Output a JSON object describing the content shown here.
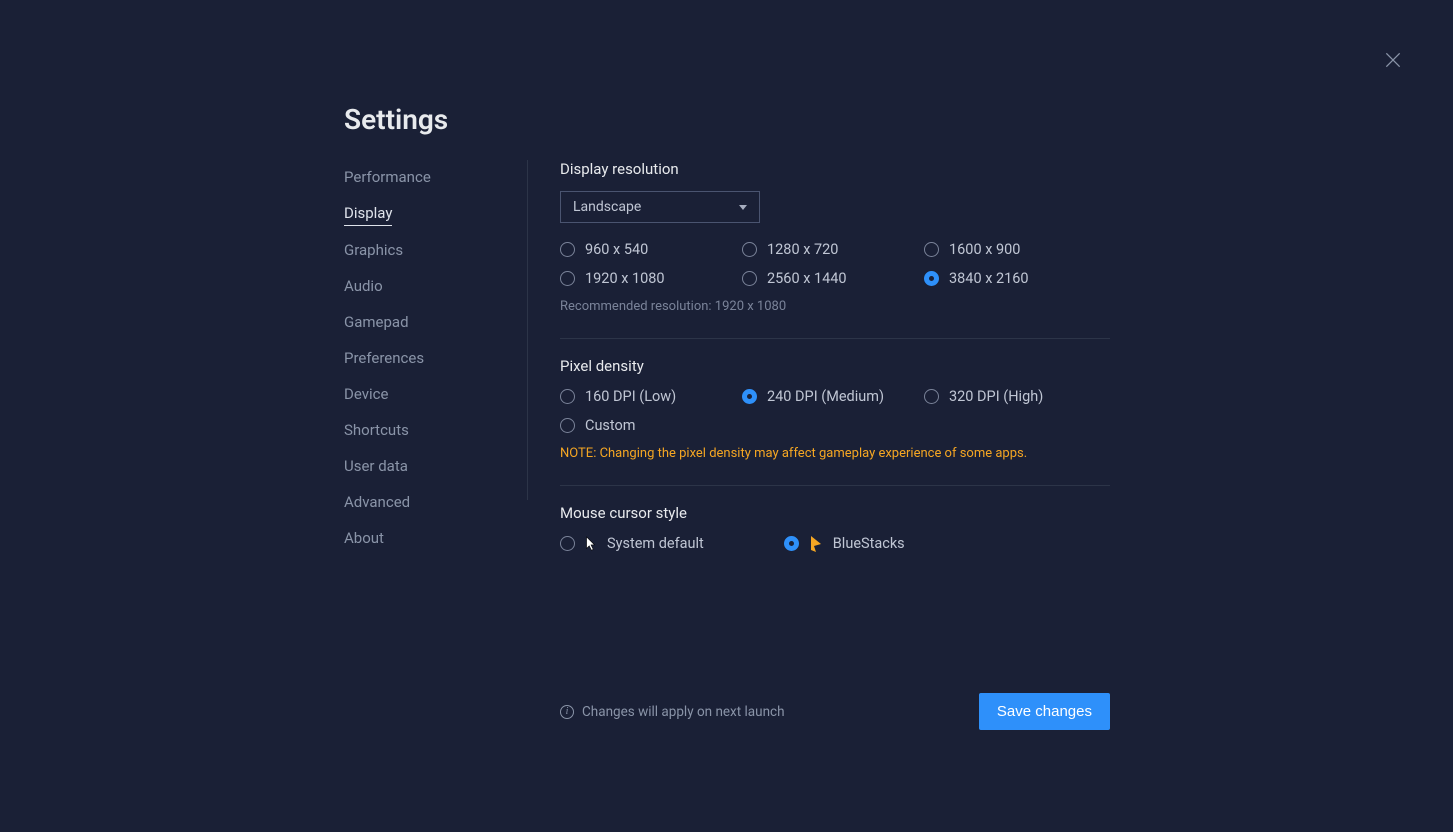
{
  "title": "Settings",
  "sidebar": {
    "items": [
      {
        "label": "Performance"
      },
      {
        "label": "Display"
      },
      {
        "label": "Graphics"
      },
      {
        "label": "Audio"
      },
      {
        "label": "Gamepad"
      },
      {
        "label": "Preferences"
      },
      {
        "label": "Device"
      },
      {
        "label": "Shortcuts"
      },
      {
        "label": "User data"
      },
      {
        "label": "Advanced"
      },
      {
        "label": "About"
      }
    ],
    "active_index": 1
  },
  "display": {
    "resolution_title": "Display resolution",
    "orientation_selection": "Landscape",
    "resolutions": [
      "960 x 540",
      "1280 x 720",
      "1600 x 900",
      "1920 x 1080",
      "2560 x 1440",
      "3840 x 2160"
    ],
    "resolution_selected_index": 5,
    "recommended_label": "Recommended resolution: 1920 x 1080",
    "pixel_density_title": "Pixel density",
    "densities": [
      "160 DPI (Low)",
      "240 DPI (Medium)",
      "320 DPI (High)",
      "Custom"
    ],
    "density_selected_index": 1,
    "density_note": "NOTE: Changing the pixel density may affect gameplay experience of some apps.",
    "cursor_title": "Mouse cursor style",
    "cursor_options": [
      "System default",
      "BlueStacks"
    ],
    "cursor_selected_index": 1
  },
  "footer": {
    "info_text": "Changes will apply on next launch",
    "save_label": "Save changes"
  }
}
